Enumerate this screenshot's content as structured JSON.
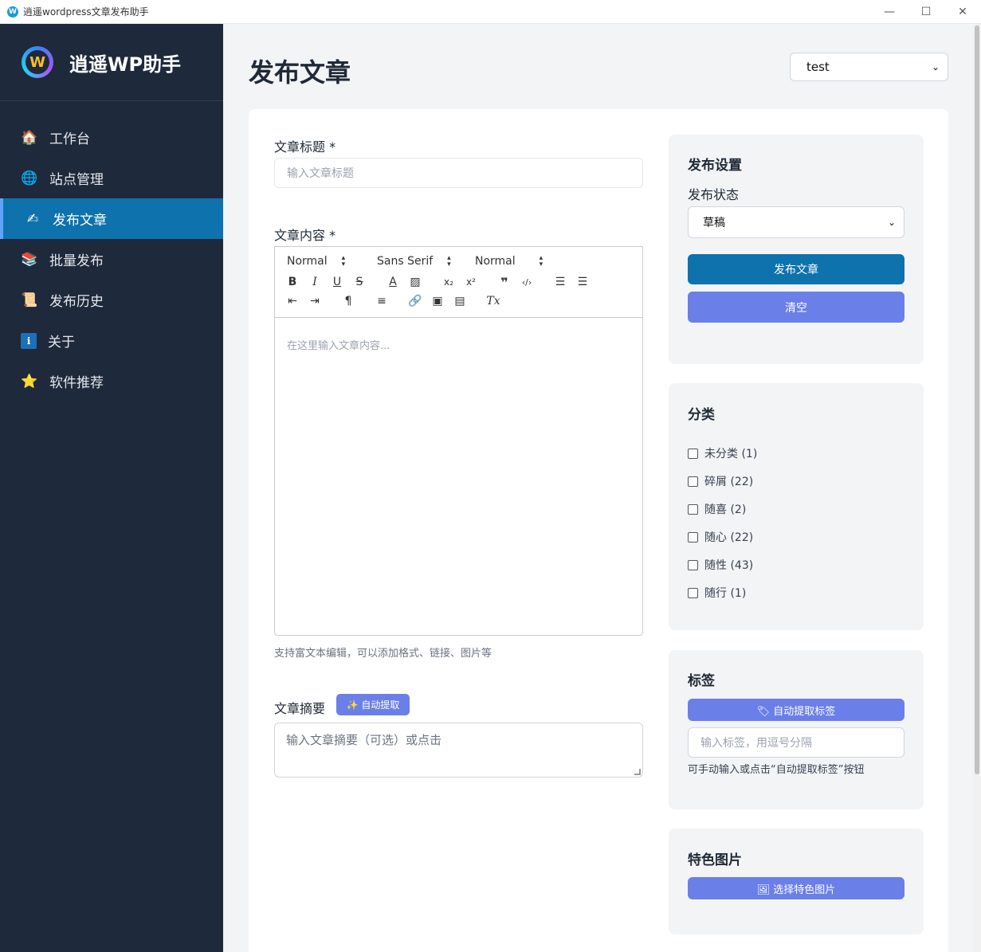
{
  "window": {
    "title": "逍遥wordpress文章发布助手",
    "icon_letter": "W",
    "minimize": "—",
    "maximize": "☐",
    "close": "✕"
  },
  "brand": {
    "logo_letter": "W",
    "name": "逍遥WP助手"
  },
  "nav": [
    {
      "label": "工作台",
      "icon": "🏠",
      "icon_name": "home-icon"
    },
    {
      "label": "站点管理",
      "icon": "🌐",
      "icon_name": "globe-icon"
    },
    {
      "label": "发布文章",
      "icon": "✍",
      "icon_name": "writing-hand-icon",
      "active": true
    },
    {
      "label": "批量发布",
      "icon": "📚",
      "icon_name": "books-icon"
    },
    {
      "label": "发布历史",
      "icon": "📜",
      "icon_name": "scroll-icon"
    },
    {
      "label": "关于",
      "icon": "ℹ",
      "icon_name": "info-icon"
    },
    {
      "label": "软件推荐",
      "icon": "⭐",
      "icon_name": "star-icon"
    }
  ],
  "header": {
    "title": "发布文章",
    "site_select": "test"
  },
  "form": {
    "title_label": "文章标题 *",
    "title_placeholder": "输入文章标题",
    "content_label": "文章内容 *",
    "toolbar": {
      "header_select": "Normal",
      "font_select": "Sans Serif",
      "size_select": "Normal"
    },
    "content_placeholder": "在这里输入文章内容...",
    "content_hint": "支持富文本编辑，可以添加格式、链接、图片等",
    "excerpt_label": "文章摘要",
    "excerpt_auto_button": "✨ 自动提取",
    "excerpt_placeholder": "输入文章摘要（可选）或点击"
  },
  "publish_panel": {
    "title": "发布设置",
    "status_label": "发布状态",
    "status_value": "草稿",
    "publish_button": "发布文章",
    "clear_button": "清空"
  },
  "category_panel": {
    "title": "分类",
    "items": [
      {
        "label": "未分类 (1)"
      },
      {
        "label": "碎屑 (22)"
      },
      {
        "label": "随喜 (2)"
      },
      {
        "label": "随心 (22)"
      },
      {
        "label": "随性 (43)"
      },
      {
        "label": "随行 (1)"
      }
    ]
  },
  "tags_panel": {
    "title": "标签",
    "auto_button": "🏷 自动提取标签",
    "input_placeholder": "输入标签，用逗号分隔",
    "hint": "可手动输入或点击“自动提取标签”按钮"
  },
  "image_panel": {
    "title": "特色图片",
    "select_button": "🖼 选择特色图片"
  },
  "colors": {
    "sidebar_bg": "#1e293b",
    "active_nav": "#0e72ad",
    "primary_button": "#0e72ad",
    "secondary_button": "#6b7fe8"
  }
}
